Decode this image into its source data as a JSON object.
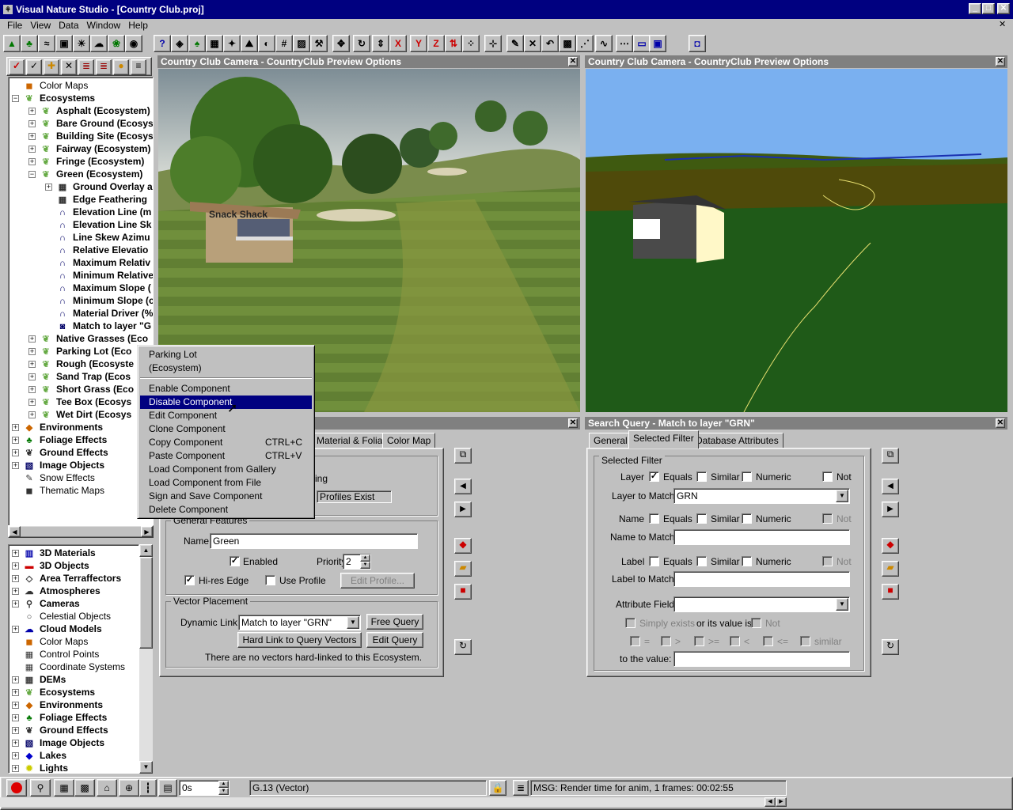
{
  "app": {
    "title": "Visual Nature Studio - [Country Club.proj]"
  },
  "menu": [
    "File",
    "View",
    "Data",
    "Window",
    "Help"
  ],
  "toolbar_icons": [
    "terrain-icon",
    "foliage-icon",
    "water-icon",
    "database-icon",
    "sun-icon",
    "atmosphere-icon",
    "ecosystem-icon",
    "camera-icon",
    "help-icon",
    "view-icon",
    "tree-icon",
    "map-icon",
    "color-icon",
    "landscape-icon",
    "sky-icon",
    "grid-icon",
    "photo-icon",
    "tools-icon",
    "move-icon",
    "rotate-icon",
    "scale-icon",
    "x-axis-icon",
    "y-axis-icon",
    "z-axis-icon",
    "elevation-icon",
    "points-icon",
    "add-point-icon",
    "edit-point-icon",
    "delete-point-icon",
    "undo-icon",
    "marquee-icon",
    "vertex-icon",
    "smooth-icon",
    "interp-icon",
    "window-icon",
    "render-icon",
    "preview-icon"
  ],
  "left_tree_top": [
    {
      "label": "Color Maps",
      "level": 0,
      "bold": false,
      "exp": "",
      "icon": "color-map-icon"
    },
    {
      "label": "Ecosystems",
      "level": 0,
      "bold": true,
      "exp": "−",
      "icon": "ecosystem-icon"
    },
    {
      "label": "Asphalt (Ecosystem)",
      "level": 1,
      "bold": true,
      "exp": "+",
      "icon": "ecosystem-icon"
    },
    {
      "label": "Bare Ground (Ecosys",
      "level": 1,
      "bold": true,
      "exp": "+",
      "icon": "ecosystem-icon"
    },
    {
      "label": "Building Site (Ecosys",
      "level": 1,
      "bold": true,
      "exp": "+",
      "icon": "ecosystem-icon"
    },
    {
      "label": "Fairway (Ecosystem)",
      "level": 1,
      "bold": true,
      "exp": "+",
      "icon": "ecosystem-icon"
    },
    {
      "label": "Fringe (Ecosystem)",
      "level": 1,
      "bold": true,
      "exp": "+",
      "icon": "ecosystem-icon"
    },
    {
      "label": "Green (Ecosystem)",
      "level": 1,
      "bold": true,
      "exp": "−",
      "icon": "ecosystem-icon"
    },
    {
      "label": "Ground Overlay a",
      "level": 2,
      "bold": true,
      "exp": "+",
      "icon": "overlay-icon"
    },
    {
      "label": "Edge Feathering",
      "level": 2,
      "bold": true,
      "exp": "",
      "icon": "feather-icon"
    },
    {
      "label": "Elevation Line (m",
      "level": 2,
      "bold": true,
      "exp": "",
      "icon": "curve-icon"
    },
    {
      "label": "Elevation Line Sk",
      "level": 2,
      "bold": true,
      "exp": "",
      "icon": "curve-icon"
    },
    {
      "label": "Line Skew Azimu",
      "level": 2,
      "bold": true,
      "exp": "",
      "icon": "curve-icon"
    },
    {
      "label": "Relative Elevatio",
      "level": 2,
      "bold": true,
      "exp": "",
      "icon": "curve-icon"
    },
    {
      "label": "Maximum Relativ",
      "level": 2,
      "bold": true,
      "exp": "",
      "icon": "curve-icon"
    },
    {
      "label": "Minimum Relative",
      "level": 2,
      "bold": true,
      "exp": "",
      "icon": "curve-icon"
    },
    {
      "label": "Maximum Slope (",
      "level": 2,
      "bold": true,
      "exp": "",
      "icon": "curve-icon"
    },
    {
      "label": "Minimum Slope (c",
      "level": 2,
      "bold": true,
      "exp": "",
      "icon": "curve-icon"
    },
    {
      "label": "Material Driver (%",
      "level": 2,
      "bold": true,
      "exp": "",
      "icon": "curve-icon"
    },
    {
      "label": "Match to layer \"G",
      "level": 2,
      "bold": true,
      "exp": "",
      "icon": "query-icon"
    },
    {
      "label": "Native Grasses (Eco",
      "level": 1,
      "bold": true,
      "exp": "+",
      "icon": "ecosystem-icon"
    },
    {
      "label": "Parking Lot (Eco",
      "level": 1,
      "bold": true,
      "exp": "+",
      "icon": "ecosystem-icon"
    },
    {
      "label": "Rough (Ecosyste",
      "level": 1,
      "bold": true,
      "exp": "+",
      "icon": "ecosystem-icon"
    },
    {
      "label": "Sand Trap (Ecos",
      "level": 1,
      "bold": true,
      "exp": "+",
      "icon": "ecosystem-icon"
    },
    {
      "label": "Short Grass (Eco",
      "level": 1,
      "bold": true,
      "exp": "+",
      "icon": "ecosystem-icon"
    },
    {
      "label": "Tee Box (Ecosys",
      "level": 1,
      "bold": true,
      "exp": "+",
      "icon": "ecosystem-icon"
    },
    {
      "label": "Wet Dirt (Ecosys",
      "level": 1,
      "bold": true,
      "exp": "+",
      "icon": "ecosystem-icon"
    },
    {
      "label": "Environments",
      "level": 0,
      "bold": true,
      "exp": "+",
      "icon": "environment-icon"
    },
    {
      "label": "Foliage Effects",
      "level": 0,
      "bold": true,
      "exp": "+",
      "icon": "foliage-icon"
    },
    {
      "label": "Ground Effects",
      "level": 0,
      "bold": true,
      "exp": "+",
      "icon": "ground-icon"
    },
    {
      "label": "Image Objects",
      "level": 0,
      "bold": true,
      "exp": "+",
      "icon": "image-icon"
    },
    {
      "label": "Snow Effects",
      "level": 0,
      "bold": false,
      "exp": "",
      "icon": "snow-icon"
    },
    {
      "label": "Thematic Maps",
      "level": 0,
      "bold": false,
      "exp": "",
      "icon": "thematic-icon"
    }
  ],
  "left_tree_bottom": [
    {
      "label": "3D Materials",
      "bold": true,
      "exp": "+",
      "icon": "materials-icon"
    },
    {
      "label": "3D Objects",
      "bold": true,
      "exp": "+",
      "icon": "car-icon"
    },
    {
      "label": "Area Terraffectors",
      "bold": true,
      "exp": "+",
      "icon": "terraffector-icon"
    },
    {
      "label": "Atmospheres",
      "bold": true,
      "exp": "+",
      "icon": "atmosphere-icon"
    },
    {
      "label": "Cameras",
      "bold": true,
      "exp": "+",
      "icon": "camera-icon"
    },
    {
      "label": "Celestial Objects",
      "bold": false,
      "exp": "",
      "icon": "celestial-icon"
    },
    {
      "label": "Cloud Models",
      "bold": true,
      "exp": "+",
      "icon": "cloud-icon"
    },
    {
      "label": "Color Maps",
      "bold": false,
      "exp": "",
      "icon": "color-map-icon"
    },
    {
      "label": "Control Points",
      "bold": false,
      "exp": "",
      "icon": "control-point-icon"
    },
    {
      "label": "Coordinate Systems",
      "bold": false,
      "exp": "",
      "icon": "coordinate-icon"
    },
    {
      "label": "DEMs",
      "bold": true,
      "exp": "+",
      "icon": "dem-icon"
    },
    {
      "label": "Ecosystems",
      "bold": true,
      "exp": "+",
      "icon": "ecosystem-icon"
    },
    {
      "label": "Environments",
      "bold": true,
      "exp": "+",
      "icon": "environment-icon"
    },
    {
      "label": "Foliage Effects",
      "bold": true,
      "exp": "+",
      "icon": "foliage-icon"
    },
    {
      "label": "Ground Effects",
      "bold": true,
      "exp": "+",
      "icon": "ground-icon"
    },
    {
      "label": "Image Objects",
      "bold": true,
      "exp": "+",
      "icon": "image-icon"
    },
    {
      "label": "Lakes",
      "bold": true,
      "exp": "+",
      "icon": "lake-icon"
    },
    {
      "label": "Lights",
      "bold": true,
      "exp": "+",
      "icon": "light-icon"
    }
  ],
  "view_left": {
    "title": "Country Club Camera - CountryClub Preview Options",
    "sign": "Snack Shack"
  },
  "view_right": {
    "title": "Country Club Camera - CountryClub Preview Options"
  },
  "context_menu": {
    "header1": "Parking Lot",
    "header2": "(Ecosystem)",
    "items": [
      {
        "label": "Enable Component",
        "shortcut": ""
      },
      {
        "label": "Disable Component",
        "shortcut": ""
      },
      {
        "label": "Edit Component",
        "shortcut": ""
      },
      {
        "label": "Clone Component",
        "shortcut": ""
      },
      {
        "label": "Copy Component",
        "shortcut": "CTRL+C"
      },
      {
        "label": "Paste Component",
        "shortcut": "CTRL+V"
      },
      {
        "label": "Load Component from Gallery",
        "shortcut": ""
      },
      {
        "label": "Load Component from File",
        "shortcut": ""
      },
      {
        "label": "Sign and Save Component",
        "shortcut": ""
      },
      {
        "label": "Delete Component",
        "shortcut": ""
      }
    ]
  },
  "eco_editor": {
    "tabs": [
      "Material & Foliage",
      "Color Map"
    ],
    "partial_label": "ing",
    "profiles_exist": "Profiles Exist",
    "general_features": "General Features",
    "name_label": "Name",
    "name_value": "Green",
    "enabled_label": "Enabled",
    "priority_label": "Priority",
    "priority_value": "2",
    "hires_label": "Hi-res Edge",
    "use_profile_label": "Use Profile",
    "edit_profile": "Edit Profile...",
    "vector_placement": "Vector Placement",
    "dynamic_link_label": "Dynamic Link",
    "dynamic_link_value": "Match to layer \"GRN\"",
    "free_query": "Free Query",
    "hard_link": "Hard Link to Query Vectors",
    "edit_query": "Edit Query",
    "no_vectors": "There are no vectors hard-linked to this Ecosystem."
  },
  "search_query": {
    "title": "Search Query - Match to layer \"GRN\"",
    "tabs": [
      "General",
      "Selected Filter",
      "Database Attributes"
    ],
    "group": "Selected Filter",
    "layer": "Layer",
    "name": "Name",
    "label": "Label",
    "equals": "Equals",
    "similar": "Similar",
    "numeric": "Numeric",
    "not": "Not",
    "layer_to_match": "Layer to Match",
    "layer_value": "GRN",
    "name_to_match": "Name to Match",
    "label_to_match": "Label to Match",
    "attribute_field": "Attribute Field",
    "simply_exists": "Simply exists",
    "or_value": "or its value is",
    "ops": [
      "=",
      ">",
      ">=",
      "<",
      "<=",
      "similar"
    ],
    "to_value": "to the value:"
  },
  "statusbar": {
    "time": "0s",
    "coords": "G.13 (Vector)",
    "msg": "MSG: Render time for anim, 1 frames:  00:02:55"
  }
}
